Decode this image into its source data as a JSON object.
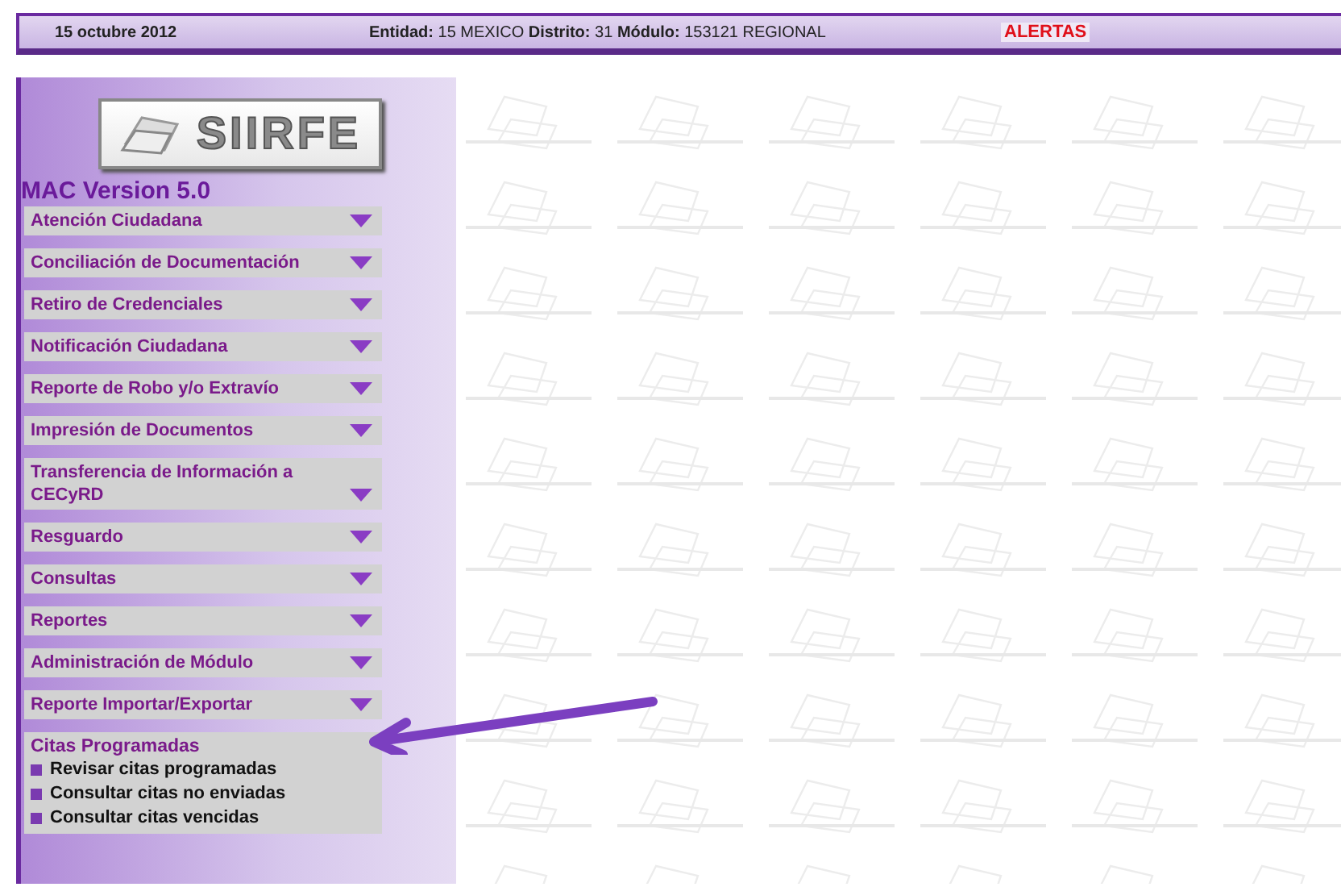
{
  "header": {
    "date": "15 octubre 2012",
    "location": "**Entidad:** 15 MEXICO **Distrito:** 31 **Módulo:** 153121 REGIONAL",
    "alerts": "ALERTAS"
  },
  "sidebar": {
    "logo": "SIIRFE",
    "version": "MAC Version 5.0",
    "items": [
      {
        "label": "Atención Ciudadana",
        "expanded": false
      },
      {
        "label": "Conciliación de Documentación",
        "expanded": false
      },
      {
        "label": "Retiro de Credenciales",
        "expanded": false
      },
      {
        "label": "Notificación Ciudadana",
        "expanded": false
      },
      {
        "label": "Reporte de Robo y/o Extravío",
        "expanded": false
      },
      {
        "label": "Impresión de Documentos",
        "expanded": false
      },
      {
        "label": "Transferencia de Información a CECyRD",
        "expanded": false
      },
      {
        "label": "Resguardo",
        "expanded": false
      },
      {
        "label": "Consultas",
        "expanded": false
      },
      {
        "label": "Reportes",
        "expanded": false
      },
      {
        "label": "Administración de Módulo",
        "expanded": false
      },
      {
        "label": "Reporte Importar/Exportar",
        "expanded": false
      },
      {
        "label": "Citas Programadas",
        "expanded": true,
        "children": [
          {
            "label": "Revisar citas programadas"
          },
          {
            "label": "Consultar citas no enviadas"
          },
          {
            "label": "Consultar citas vencidas"
          }
        ]
      }
    ]
  }
}
